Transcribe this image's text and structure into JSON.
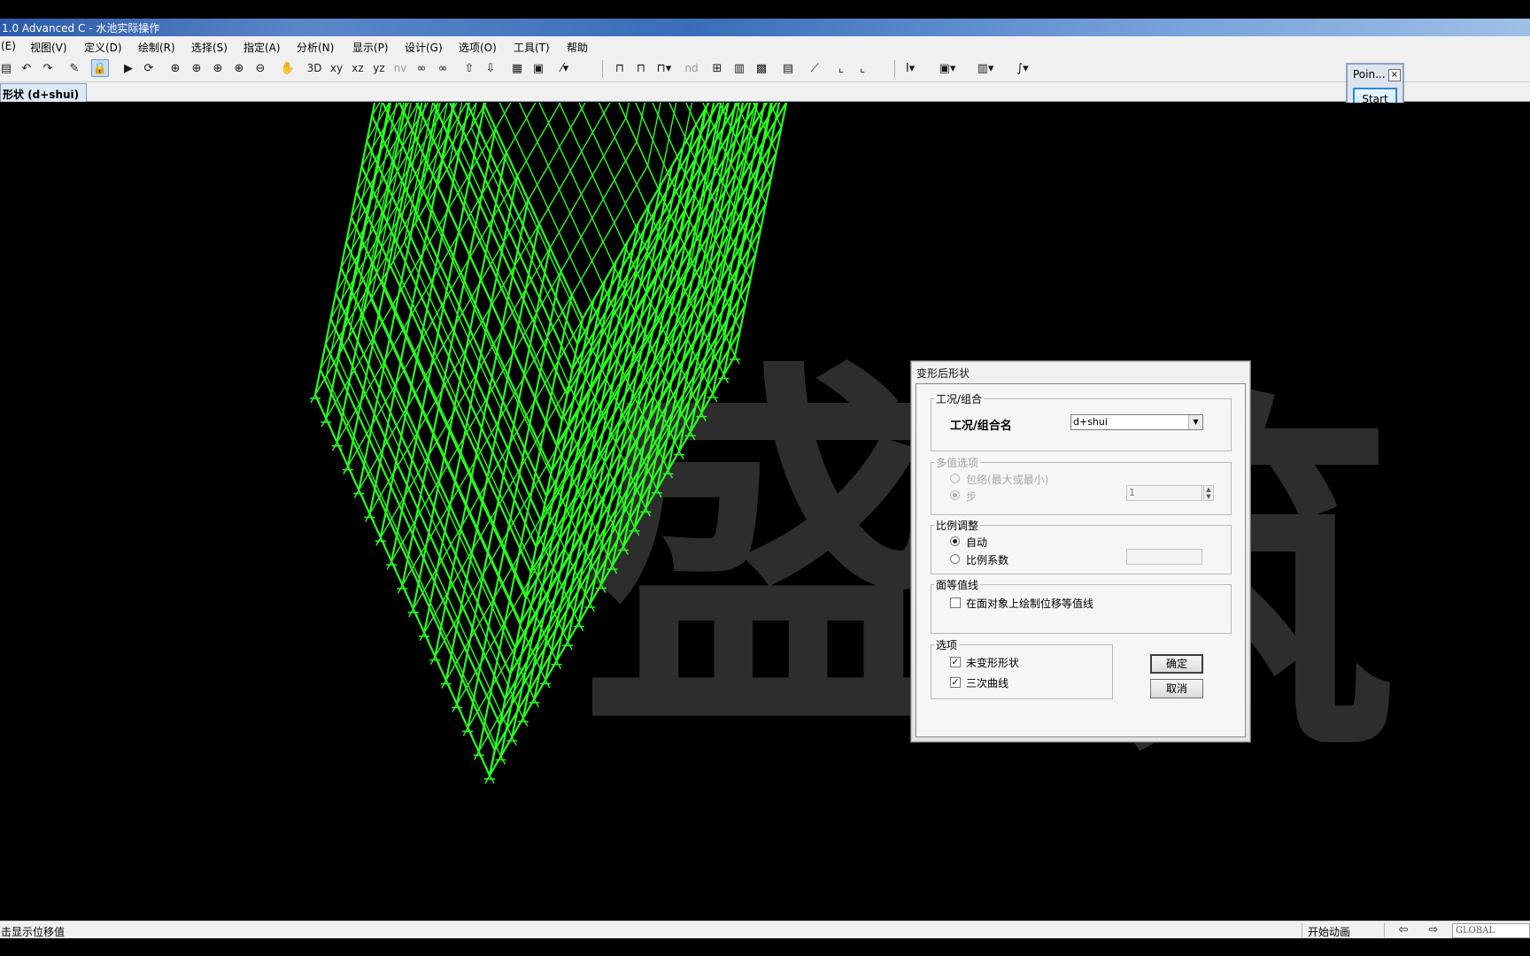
{
  "window": {
    "title": "1.0 Advanced C  - 水池实际操作"
  },
  "menu": {
    "items": [
      "(E)",
      "视图(V)",
      "定义(D)",
      "绘制(R)",
      "选择(S)",
      "指定(A)",
      "分析(N)",
      "显示(P)",
      "设计(G)",
      "选项(O)",
      "工具(T)",
      "帮助"
    ]
  },
  "toolbar": {
    "text_buttons": {
      "view_3d": "3D",
      "view_xy": "xy",
      "view_xz": "xz",
      "view_yz": "yz",
      "view_nv": "nv",
      "nd": "nd"
    }
  },
  "tab": {
    "label": "形状 (d+shui)"
  },
  "point_window": {
    "title": "Poin...",
    "close": "×",
    "start": "Start"
  },
  "watermark": {
    "chars": [
      "盛",
      "筑"
    ]
  },
  "dialog": {
    "title": "变形后形状",
    "case_group": {
      "label": "工况/组合",
      "name_label": "工况/组合名",
      "value": "d+shui"
    },
    "multi_group": {
      "label": "多值选项",
      "envelope_label": "包络(最大或最小)",
      "step_label": "步",
      "step_value": "1"
    },
    "scale_group": {
      "label": "比例调整",
      "auto_label": "自动",
      "factor_label": "比例系数"
    },
    "contour_group": {
      "label": "面等值线",
      "contour_label": "在面对象上绘制位移等值线"
    },
    "options_group": {
      "label": "选项",
      "undeformed_label": "未变形形状",
      "cubic_label": "三次曲线",
      "check_mark": "✓"
    },
    "ok_label": "确定",
    "cancel_label": "取消"
  },
  "status": {
    "left_text": "击显示位移值",
    "animation_label": "开始动画",
    "coord_system": "GLOBAL"
  },
  "colors": {
    "mesh": "#28ff1e",
    "watermark": "#3c3c3c",
    "title_bar": "#3a6db8"
  }
}
